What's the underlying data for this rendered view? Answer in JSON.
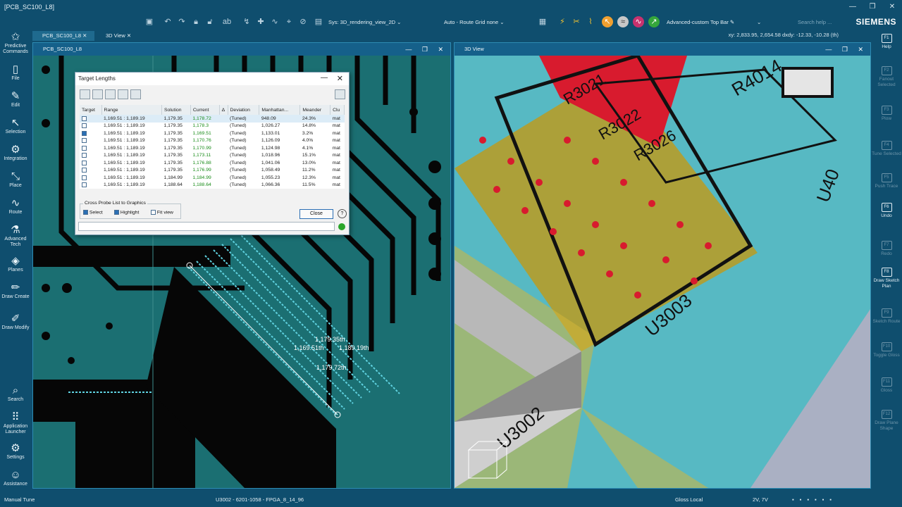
{
  "title": "[PCB_SC100_L8]",
  "window_controls": [
    "—",
    "❐",
    "✕"
  ],
  "toolbar": {
    "view_select": "Sys: 3D_rendering_view_2D",
    "grid_select": "Auto - Route Grid none",
    "topbar_select": "Advanced-custom Top Bar",
    "search_placeholder": "Search help ...",
    "brand": "SIEMENS"
  },
  "tabs": [
    {
      "label": "PCB_SC100_L8",
      "active": true
    },
    {
      "label": "3D View",
      "active": false
    }
  ],
  "coords": "xy: 2,833.95, 2,654.58  dxdy: -12.33, -10.28  (th)",
  "left_nav": [
    {
      "label": "Predictive Commands",
      "icon": "star-icon"
    },
    {
      "label": "File",
      "icon": "file-icon"
    },
    {
      "label": "Edit",
      "icon": "pencil-icon"
    },
    {
      "label": "Selection",
      "icon": "cursor-icon"
    },
    {
      "label": "Integration",
      "icon": "gear-icon"
    },
    {
      "label": "Place",
      "icon": "place-icon"
    },
    {
      "label": "Route",
      "icon": "route-icon"
    },
    {
      "label": "Advanced Tech",
      "icon": "advanced-icon"
    },
    {
      "label": "Planes",
      "icon": "layers-icon"
    },
    {
      "label": "Draw Create",
      "icon": "draw-icon"
    },
    {
      "label": "Draw Modify",
      "icon": "modify-icon"
    },
    {
      "label": "Search",
      "icon": "search-icon"
    },
    {
      "label": "Application Launcher",
      "icon": "grid-icon"
    },
    {
      "label": "Settings",
      "icon": "settings-icon"
    },
    {
      "label": "Assistance",
      "icon": "person-icon"
    }
  ],
  "right_nav": [
    {
      "key": "F1",
      "label": "Help",
      "enabled": true
    },
    {
      "key": "F2",
      "label": "Fanout Selected",
      "enabled": false
    },
    {
      "key": "F3",
      "label": "Plow",
      "enabled": false
    },
    {
      "key": "F4",
      "label": "Tune Selected",
      "enabled": false
    },
    {
      "key": "F5",
      "label": "Push Trace",
      "enabled": false
    },
    {
      "key": "F6",
      "label": "Undo",
      "enabled": true
    },
    {
      "key": "F7",
      "label": "Redo",
      "enabled": false
    },
    {
      "key": "F8",
      "label": "Draw Sketch Plan",
      "enabled": true
    },
    {
      "key": "F9",
      "label": "Sketch Route",
      "enabled": false
    },
    {
      "key": "F10",
      "label": "Toggle Gloss",
      "enabled": false
    },
    {
      "key": "F11",
      "label": "Gloss",
      "enabled": false
    },
    {
      "key": "F12",
      "label": "Draw Plane Shape",
      "enabled": false
    }
  ],
  "pcb_panel": {
    "title": "PCB_SC100_L8",
    "labels": [
      "1,179.35th",
      "1,169.51th",
      "1,189.19th",
      "1,179.72th"
    ]
  },
  "view3d_panel": {
    "title": "3D View",
    "labels": [
      "R4014",
      "U3003",
      "U3002",
      "U40",
      "R3021",
      "R3022",
      "R3026"
    ]
  },
  "dialog": {
    "title": "Target Lengths",
    "columns": [
      "Target",
      "Range",
      "Solution",
      "Current",
      "Δ",
      "Deviation",
      "Manhattan...",
      "Meander",
      "Clu"
    ],
    "rows": [
      {
        "checked": false,
        "range": "1,169.51 : 1,189.19",
        "solution": "1,179.35",
        "current": "1,178.72",
        "dev": "(Tuned)",
        "manh": "948.09",
        "meander": "24.3%",
        "clu": "mat"
      },
      {
        "checked": false,
        "range": "1,169.51 : 1,189.19",
        "solution": "1,179.35",
        "current": "1,178.3",
        "dev": "(Tuned)",
        "manh": "1,026.27",
        "meander": "14.8%",
        "clu": "mat"
      },
      {
        "checked": true,
        "range": "1,169.51 : 1,189.19",
        "solution": "1,179.35",
        "current": "1,169.51",
        "dev": "(Tuned)",
        "manh": "1,133.01",
        "meander": "3.2%",
        "clu": "mat"
      },
      {
        "checked": false,
        "range": "1,169.51 : 1,189.19",
        "solution": "1,179.35",
        "current": "1,170.76",
        "dev": "(Tuned)",
        "manh": "1,126.09",
        "meander": "4.0%",
        "clu": "mat"
      },
      {
        "checked": false,
        "range": "1,169.51 : 1,189.19",
        "solution": "1,179.35",
        "current": "1,170.99",
        "dev": "(Tuned)",
        "manh": "1,124.98",
        "meander": "4.1%",
        "clu": "mat"
      },
      {
        "checked": false,
        "range": "1,169.51 : 1,189.19",
        "solution": "1,179.35",
        "current": "1,173.11",
        "dev": "(Tuned)",
        "manh": "1,018.96",
        "meander": "15.1%",
        "clu": "mat"
      },
      {
        "checked": false,
        "range": "1,169.51 : 1,189.19",
        "solution": "1,179.35",
        "current": "1,176.88",
        "dev": "(Tuned)",
        "manh": "1,041.06",
        "meander": "13.0%",
        "clu": "mat"
      },
      {
        "checked": false,
        "range": "1,169.51 : 1,189.19",
        "solution": "1,179.35",
        "current": "1,176.99",
        "dev": "(Tuned)",
        "manh": "1,058.49",
        "meander": "11.2%",
        "clu": "mat"
      },
      {
        "checked": false,
        "range": "1,169.51 : 1,189.19",
        "solution": "1,184.99",
        "current": "1,184.99",
        "dev": "(Tuned)",
        "manh": "1,055.23",
        "meander": "12.3%",
        "clu": "mat"
      },
      {
        "checked": false,
        "range": "1,169.51 : 1,189.19",
        "solution": "1,188.64",
        "current": "1,188.64",
        "dev": "(Tuned)",
        "manh": "1,066.36",
        "meander": "11.5%",
        "clu": "mat"
      }
    ],
    "cross_probe": {
      "legend": "Cross Probe List to Graphics",
      "select": "Select",
      "highlight": "Highlight",
      "fit": "Fit view"
    },
    "close_label": "Close"
  },
  "status": {
    "mode": "Manual Tune",
    "part": "U3002 - 6201-1058 - FPGA_8_14_96",
    "gloss": "Gloss Local",
    "layers": "2V, 7V"
  }
}
